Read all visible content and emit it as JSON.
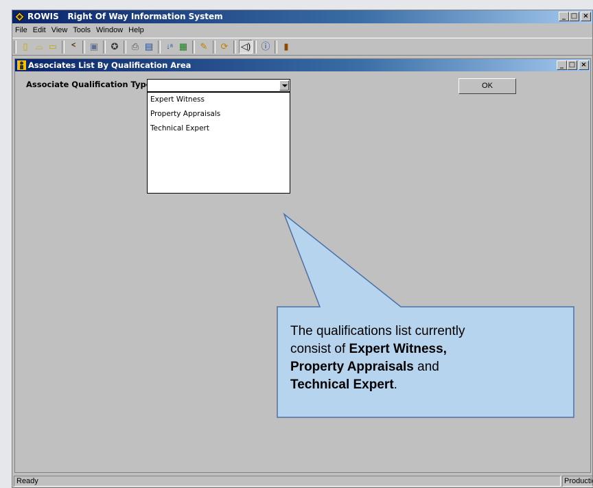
{
  "app": {
    "title": "ROWIS   Right Of Way Information System",
    "window_buttons": {
      "minimize": "_",
      "maximize": "□",
      "close": "×"
    }
  },
  "menu": [
    "File",
    "Edit",
    "View",
    "Tools",
    "Window",
    "Help"
  ],
  "toolbar": {
    "icons": [
      "new-icon",
      "open-icon",
      "folder-icon",
      "binoculars-icon",
      "save-icon",
      "wizard-icon",
      "print-icon",
      "report-icon",
      "sort-icon",
      "filter-icon",
      "pencil-icon",
      "refresh-icon",
      "sound-icon",
      "help-icon",
      "exit-icon"
    ]
  },
  "child_window": {
    "title": "Associates List By Qualification Area",
    "label": "Associate Qualification Type:",
    "combo_value": "",
    "options": [
      "Expert Witness",
      "Property Appraisals",
      "Technical Expert"
    ],
    "ok_label": "OK"
  },
  "callout": {
    "line1": "The qualifications list currently",
    "line2_prefix": "consist of ",
    "line2_bold": "Expert Witness,",
    "line3_bold": "Property Appraisals",
    "line3_suffix": " and",
    "line4_bold": "Technical Expert",
    "line4_suffix": "."
  },
  "status": {
    "left": "Ready",
    "right": "Production"
  },
  "colors": {
    "titlebar_start": "#0a246a",
    "titlebar_end": "#a6caf0",
    "window_bg": "#c0c0c0",
    "callout_fill": "#b7d4ef",
    "callout_stroke": "#4a6fa5"
  }
}
